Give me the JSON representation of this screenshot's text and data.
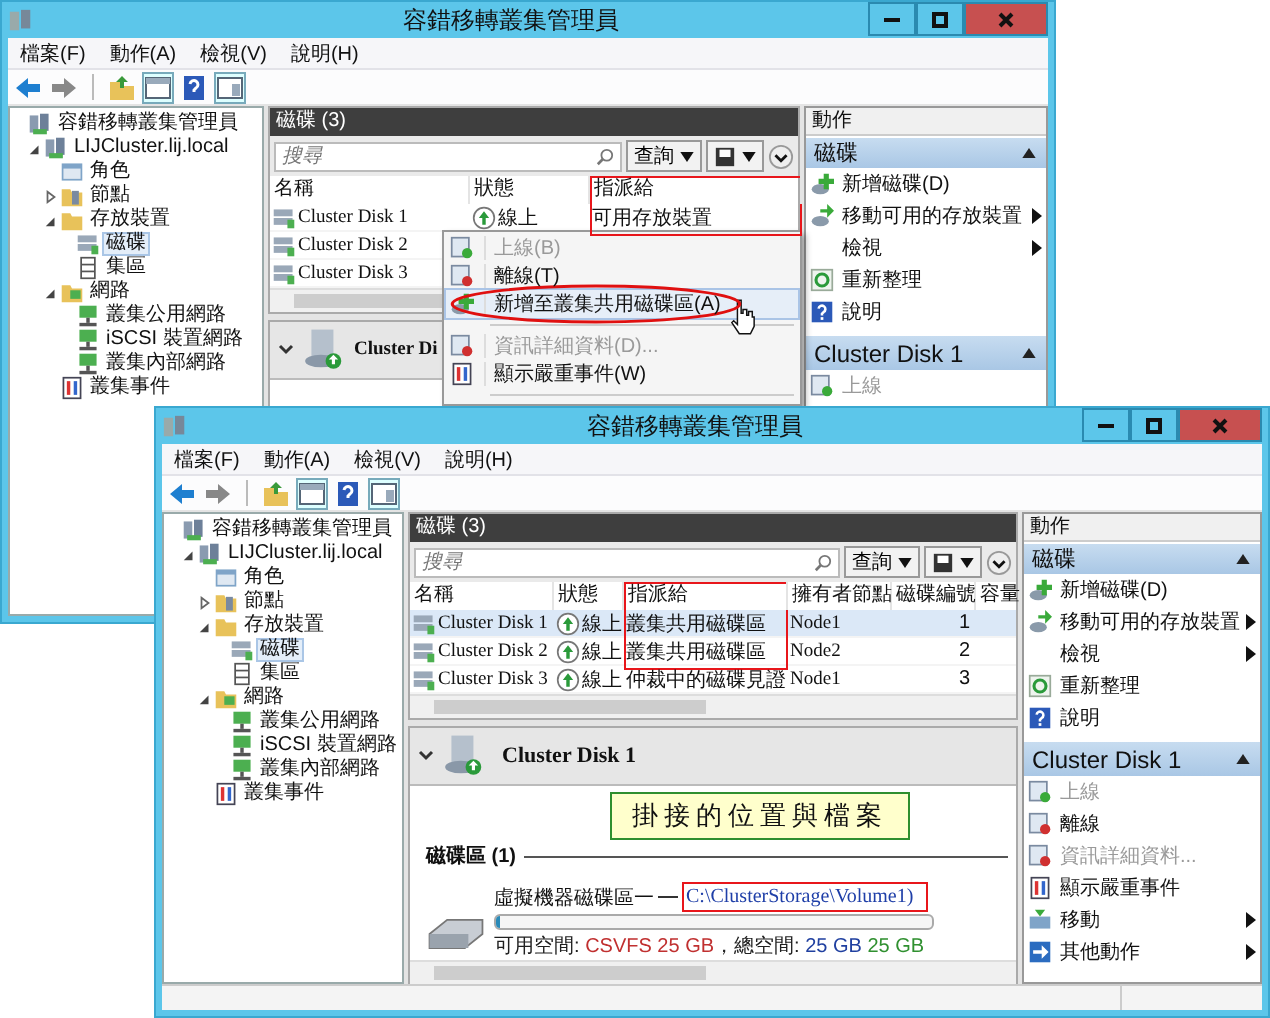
{
  "windows": [
    {
      "title": "容錯移轉叢集管理員",
      "menu": [
        "檔案(F)",
        "動作(A)",
        "檢視(V)",
        "說明(H)"
      ],
      "tree": [
        {
          "label": "容錯移轉叢集管理員",
          "kind": "manager",
          "children": [
            {
              "label": "LIJCluster.lij.local",
              "kind": "cluster",
              "expanded": true,
              "children": [
                {
                  "label": "角色",
                  "kind": "roles"
                },
                {
                  "label": "節點",
                  "kind": "nodes",
                  "expanded": false
                },
                {
                  "label": "存放裝置",
                  "kind": "storage",
                  "expanded": true,
                  "children": [
                    {
                      "label": "磁碟",
                      "kind": "disks",
                      "selected": true
                    },
                    {
                      "label": "集區",
                      "kind": "pools",
                      "selected": false
                    }
                  ]
                },
                {
                  "label": "網路",
                  "kind": "networks",
                  "expanded": true,
                  "children": [
                    {
                      "label": "叢集公用網路",
                      "kind": "network"
                    },
                    {
                      "label": "iSCSI 裝置網路",
                      "kind": "network"
                    },
                    {
                      "label": "叢集內部網路",
                      "kind": "network"
                    }
                  ]
                },
                {
                  "label": "叢集事件",
                  "kind": "events"
                }
              ]
            }
          ]
        }
      ],
      "disks": {
        "title": "磁碟 (3)",
        "search_placeholder": "搜尋",
        "query_button": "查詢",
        "columns": [
          {
            "label": "名稱",
            "outlined": false
          },
          {
            "label": "狀態",
            "outlined": false
          },
          {
            "label": "指派給",
            "outlined": true
          }
        ],
        "rows": [
          {
            "cells": [
              "Cluster Disk 1",
              "線上",
              "可用存放裝置"
            ],
            "selected": false,
            "outlined": true
          },
          {
            "cells": [
              "Cluster Disk 2"
            ],
            "selected": false,
            "outlined": false
          },
          {
            "cells": [
              "Cluster Disk 3"
            ],
            "selected": false,
            "outlined": false
          }
        ]
      },
      "context_menu": [
        {
          "label": "上線(B)",
          "kind": "online",
          "disabled": true,
          "circled": false
        },
        {
          "label": "離線(T)",
          "kind": "offline",
          "disabled": false,
          "circled": false
        },
        {
          "label": "新增至叢集共用磁碟區(A)",
          "kind": "add",
          "disabled": false,
          "circled": true
        },
        {
          "label": "資訊詳細資料(D)...",
          "kind": "details",
          "disabled": true,
          "circled": false
        },
        {
          "label": "顯示嚴重事件(W)",
          "kind": "events",
          "disabled": false,
          "circled": false
        }
      ],
      "details": {
        "title": "Cluster Di"
      },
      "actions": {
        "title": "動作",
        "sections": [
          {
            "title": "磁碟",
            "items": [
              {
                "label": "新增磁碟(D)",
                "kind": "add",
                "submenu": false,
                "disabled": false
              },
              {
                "label": "移動可用的存放裝置",
                "kind": "move",
                "submenu": true,
                "disabled": false
              },
              {
                "label": "檢視",
                "kind": "plain",
                "submenu": true,
                "disabled": false
              },
              {
                "label": "重新整理",
                "kind": "refresh",
                "submenu": false,
                "disabled": false
              },
              {
                "label": "說明",
                "kind": "help",
                "submenu": false,
                "disabled": false
              }
            ]
          },
          {
            "title": "Cluster Disk 1",
            "items": [
              {
                "label": "上線",
                "kind": "online",
                "submenu": false,
                "disabled": true
              }
            ]
          }
        ]
      }
    },
    {
      "title": "容錯移轉叢集管理員",
      "menu": [
        "檔案(F)",
        "動作(A)",
        "檢視(V)",
        "說明(H)"
      ],
      "tree": [
        {
          "label": "容錯移轉叢集管理員",
          "kind": "manager",
          "children": [
            {
              "label": "LIJCluster.lij.local",
              "kind": "cluster",
              "expanded": true,
              "children": [
                {
                  "label": "角色",
                  "kind": "roles"
                },
                {
                  "label": "節點",
                  "kind": "nodes",
                  "expanded": false
                },
                {
                  "label": "存放裝置",
                  "kind": "storage",
                  "expanded": true,
                  "children": [
                    {
                      "label": "磁碟",
                      "kind": "disks",
                      "selected": true
                    },
                    {
                      "label": "集區",
                      "kind": "pools",
                      "selected": false
                    }
                  ]
                },
                {
                  "label": "網路",
                  "kind": "networks",
                  "expanded": true,
                  "children": [
                    {
                      "label": "叢集公用網路",
                      "kind": "network"
                    },
                    {
                      "label": "iSCSI 裝置網路",
                      "kind": "network"
                    },
                    {
                      "label": "叢集內部網路",
                      "kind": "network"
                    }
                  ]
                },
                {
                  "label": "叢集事件",
                  "kind": "events"
                }
              ]
            }
          ]
        }
      ],
      "disks": {
        "title": "磁碟 (3)",
        "search_placeholder": "搜尋",
        "query_button": "查詢",
        "columns": [
          {
            "label": "名稱",
            "outlined": false
          },
          {
            "label": "狀態",
            "outlined": false
          },
          {
            "label": "指派給",
            "outlined": true
          },
          {
            "label": "擁有者節點",
            "outlined": false
          },
          {
            "label": "磁碟編號",
            "outlined": false
          },
          {
            "label": "容量",
            "outlined": false
          }
        ],
        "rows": [
          {
            "cells": [
              "Cluster Disk 1",
              "線上",
              "叢集共用磁碟區",
              "Node1",
              "1"
            ],
            "selected": true,
            "outlined": true
          },
          {
            "cells": [
              "Cluster Disk 2",
              "線上",
              "叢集共用磁碟區",
              "Node2",
              "2"
            ],
            "selected": false,
            "outlined": true
          },
          {
            "cells": [
              "Cluster Disk 3",
              "線上",
              "仲裁中的磁碟見證",
              "Node1",
              "3"
            ],
            "selected": false,
            "outlined": false
          }
        ]
      },
      "details": {
        "title": "Cluster Disk 1",
        "callout": "掛接的位置與檔案",
        "volumes_title": "磁碟區 (1)",
        "volume": {
          "name": "虛擬機器磁碟區一",
          "path": "C:\\ClusterStorage\\Volume1)",
          "path_outlined": true,
          "level": 0.01,
          "space": [
            {
              "text": "可用空間: ",
              "color": "#202020"
            },
            {
              "text": "CSVFS 25 GB",
              "color": "#c03030"
            },
            {
              "text": "，總空間: ",
              "color": "#202020"
            },
            {
              "text": "25 GB ",
              "color": "#2040a0"
            },
            {
              "text": "25 GB",
              "color": "#309030"
            }
          ]
        }
      },
      "actions": {
        "title": "動作",
        "sections": [
          {
            "title": "磁碟",
            "items": [
              {
                "label": "新增磁碟(D)",
                "kind": "add",
                "submenu": false,
                "disabled": false
              },
              {
                "label": "移動可用的存放裝置",
                "kind": "move",
                "submenu": true,
                "disabled": false
              },
              {
                "label": "檢視",
                "kind": "plain",
                "submenu": true,
                "disabled": false
              },
              {
                "label": "重新整理",
                "kind": "refresh",
                "submenu": false,
                "disabled": false
              },
              {
                "label": "說明",
                "kind": "help",
                "submenu": false,
                "disabled": false
              }
            ]
          },
          {
            "title": "Cluster Disk 1",
            "items": [
              {
                "label": "上線",
                "kind": "online",
                "submenu": false,
                "disabled": true
              },
              {
                "label": "離線",
                "kind": "offline",
                "submenu": false,
                "disabled": false
              },
              {
                "label": "資訊詳細資料...",
                "kind": "details",
                "submenu": false,
                "disabled": true
              },
              {
                "label": "顯示嚴重事件",
                "kind": "events",
                "submenu": false,
                "disabled": false
              },
              {
                "label": "移動",
                "kind": "move2",
                "submenu": true,
                "disabled": false
              },
              {
                "label": "其他動作",
                "kind": "more",
                "submenu": true,
                "disabled": false
              }
            ]
          }
        ]
      }
    }
  ]
}
